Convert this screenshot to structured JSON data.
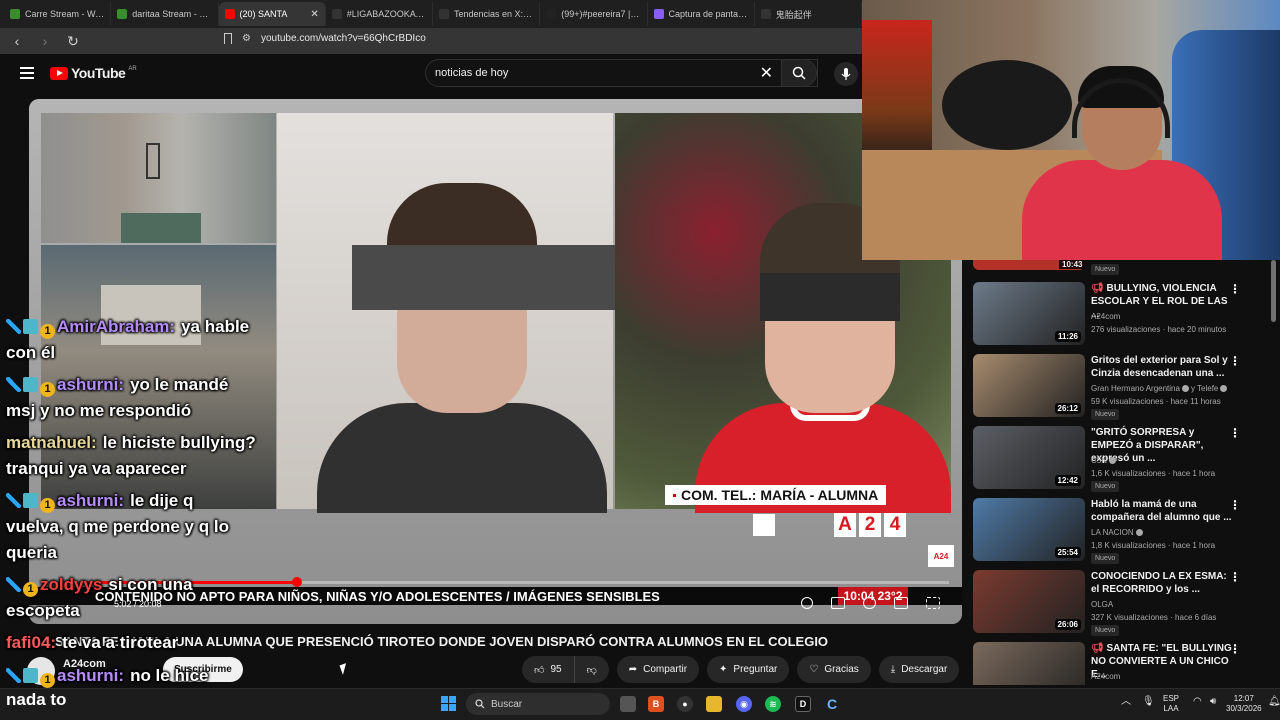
{
  "browser": {
    "tabs": [
      {
        "label": "Carre Stream - Watch",
        "icon": "twitch-icon",
        "color": "#3a8d2f"
      },
      {
        "label": "daritaa Stream - Watch",
        "icon": "twitch-icon",
        "color": "#3a8d2f"
      },
      {
        "label": "(20) SANTA",
        "icon": "youtube-icon",
        "color": "#ff0000",
        "active": true
      },
      {
        "label": "#LIGABAZOOKA en X",
        "icon": "x-icon",
        "color": "#333333"
      },
      {
        "label": "Tendencias en X: \"Ste",
        "icon": "x-icon",
        "color": "#333333"
      },
      {
        "label": "(99+)#peereira7 | pere",
        "icon": "tiktok-icon",
        "color": "#222222"
      },
      {
        "label": "Captura de pantalla pc",
        "icon": "pen-icon",
        "color": "#8a5cf6"
      },
      {
        "label": "鬼胎起伴",
        "icon": "x-icon",
        "color": "#333333"
      }
    ],
    "url": "youtube.com/watch?v=66QhCrBDIco"
  },
  "youtube": {
    "logo_text": "YouTube",
    "country": "AR",
    "search_value": "noticias de hoy"
  },
  "video": {
    "caption_tel": "COM. TEL.: MARÍA - ALUMNA",
    "a24_letters": [
      "A",
      "2",
      "4"
    ],
    "a24_small": "A24",
    "ticker": "CONTENIDO NO APTO PARA NIÑOS, NIÑAS Y/O ADOLESCENTES / IMÁGENES SENSIBLES",
    "clock": "10:04  23°2",
    "time": "5:02 / 20:08",
    "progress": 0.25,
    "title": "SANTA FE: HABLA UNA ALUMNA QUE PRESENCIÓ TIROTEO DONDE JOVEN DISPARÓ CONTRA ALUMNOS EN EL COLEGIO"
  },
  "channel": {
    "name": "A24com",
    "subscribe": "Suscribirme"
  },
  "actions": {
    "likes": "95",
    "share": "Compartir",
    "ask": "Preguntar",
    "thanks": "Gracias",
    "download": "Descargar"
  },
  "chat": [
    {
      "user": "AmirAbraham:",
      "user_color": "#b58cff",
      "line1": "ya hable",
      "line2": "con él",
      "badges": [
        "sword",
        "grid",
        "num"
      ]
    },
    {
      "user": "ashurni:",
      "user_color": "#b58cff",
      "line1": "yo le mandé",
      "line2": "msj y no me respondió",
      "badges": [
        "sword",
        "grid",
        "num"
      ]
    },
    {
      "user": "matnahuel:",
      "user_color": "#e8d99a",
      "line1": "le hiciste bullying?",
      "line2": "tranqui ya va aparecer",
      "badges": []
    },
    {
      "user": "ashurni:",
      "user_color": "#b58cff",
      "line1": "le dije q",
      "line2": "vuelva, q me perdone y q lo",
      "line3": "queria",
      "badges": [
        "sword",
        "grid",
        "num"
      ]
    },
    {
      "user": "zoldyys",
      "user_color": "#ff4040",
      "line1": "si con una",
      "line2": "escopeta",
      "badges": [
        "sword",
        "num"
      ]
    },
    {
      "user": "fafi04:",
      "user_color": "#ff5a5a",
      "line1": "te va a tirotear",
      "badges": []
    },
    {
      "user": "ashurni:",
      "user_color": "#b58cff",
      "line1": "no le hice",
      "badges": [
        "sword",
        "grid",
        "num"
      ]
    }
  ],
  "chat_tail": "nada to",
  "sidebar": {
    "partial_duration": "10:43",
    "partial_nuevo": "Nuevo",
    "items": [
      {
        "title": "BULLYING, VIOLENCIA ESCOLAR Y EL ROL DE LAS ...",
        "channel": "A24com",
        "meta": "276 visualizaciones · hace 20 minutos",
        "duration": "11:26",
        "nuevo": "",
        "thumb": "#6d7b8a",
        "live_icon": true
      },
      {
        "title": "Gritos del exterior para Sol y Cinzia desencadenan una ...",
        "channel": "Gran Hermano Argentina",
        "channel_extra": "y Telefe",
        "meta": "59 K visualizaciones · hace 11 horas",
        "duration": "26:12",
        "nuevo": "Nuevo",
        "thumb": "#a88c6e"
      },
      {
        "title": "\"GRITÓ SORPRESA y EMPEZÓ a DISPARAR\", expresó un ...",
        "channel": "C5N",
        "meta": "1,6 K visualizaciones · hace 1 hora",
        "duration": "12:42",
        "nuevo": "Nuevo",
        "thumb": "#5c5f66"
      },
      {
        "title": "Habló la mamá de una compañera del alumno que ...",
        "channel": "LA NACION",
        "meta": "1,8 K visualizaciones · hace 1 hora",
        "duration": "25:54",
        "nuevo": "Nuevo",
        "thumb": "#4f7ba8"
      },
      {
        "title": "CONOCIENDO LA EX ESMA: el RECORRIDO y los ...",
        "channel": "OLGA",
        "meta": "327 K visualizaciones · hace 6 días",
        "duration": "26:06",
        "nuevo": "Nuevo",
        "thumb": "#7b3b2f"
      },
      {
        "title": "SANTA FE: \"EL BULLYING NO CONVIERTE A UN CHICO E...",
        "channel": "A24com",
        "meta": "",
        "duration": "",
        "nuevo": "",
        "thumb": "#7b6a5c",
        "live_icon": true
      }
    ]
  },
  "taskbar": {
    "search": "Buscar",
    "lang1": "ESP",
    "lang2": "LAA",
    "time": "12:07",
    "date": "30/3/2026"
  }
}
